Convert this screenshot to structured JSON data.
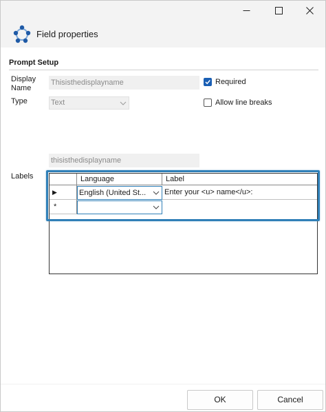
{
  "window": {
    "controls": {
      "minimize": "—",
      "maximize": "☐",
      "close": "✕"
    }
  },
  "header": {
    "title": "Field properties",
    "icon": "circle-nodes-icon",
    "accent": "#1f5aa6"
  },
  "prompt_setup": {
    "section_title": "Prompt Setup",
    "display_name_label": "Display Name",
    "display_name_value": "Thisisthedisplayname",
    "type_label": "Type",
    "type_value": "Text",
    "required_label": "Required",
    "required_checked": true,
    "allow_line_breaks_label": "Allow line breaks",
    "allow_line_breaks_checked": false,
    "secondary_value": "thisisthedisplayname"
  },
  "labels": {
    "label": "Labels",
    "columns": [
      "Language",
      "Label"
    ],
    "rows": [
      {
        "marker": "▶",
        "language": "English (United St...",
        "label": "Enter your <u> name</u>:"
      },
      {
        "marker": "*",
        "language": "",
        "label": ""
      }
    ],
    "highlight_color": "#2f7fb7"
  },
  "footer": {
    "ok_label": "OK",
    "cancel_label": "Cancel"
  }
}
